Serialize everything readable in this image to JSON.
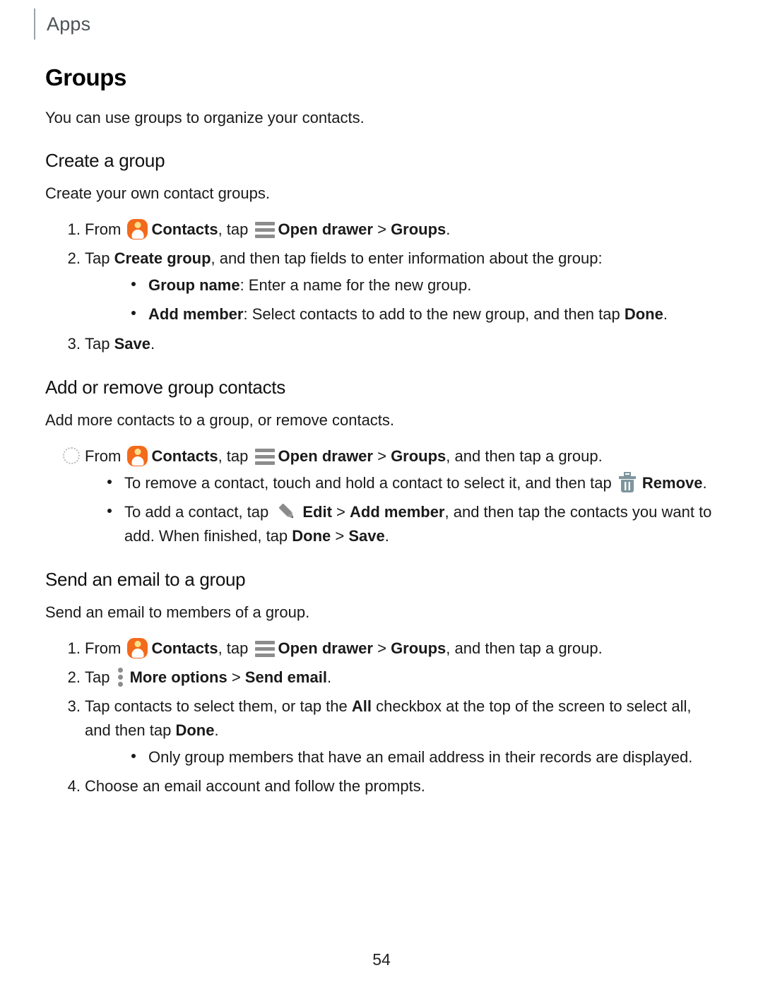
{
  "header": {
    "label": "Apps"
  },
  "doc": {
    "title": "Groups",
    "intro": "You can use groups to organize your contacts."
  },
  "icons": {
    "contacts": "contacts-app-icon",
    "open_drawer": "hamburger-menu-icon",
    "more_options": "more-options-icon",
    "remove": "trash-icon",
    "edit": "pencil-icon"
  },
  "sections": [
    {
      "id": "create-a-group",
      "heading": "Create a group",
      "intro": "Create your own contact groups.",
      "steps": [
        {
          "marker": "1.",
          "parts": [
            {
              "t": "text",
              "v": "From "
            },
            {
              "t": "icon",
              "v": "contacts"
            },
            {
              "t": "bold",
              "v": "Contacts"
            },
            {
              "t": "text",
              "v": ", tap "
            },
            {
              "t": "icon",
              "v": "open_drawer"
            },
            {
              "t": "bold",
              "v": "Open drawer"
            },
            {
              "t": "text",
              "v": " > "
            },
            {
              "t": "bold",
              "v": "Groups"
            },
            {
              "t": "text",
              "v": "."
            }
          ]
        },
        {
          "marker": "2.",
          "parts": [
            {
              "t": "text",
              "v": "Tap "
            },
            {
              "t": "bold",
              "v": "Create group"
            },
            {
              "t": "text",
              "v": ", and then tap fields to enter information about the group:"
            }
          ],
          "subbullets": [
            [
              {
                "t": "bold",
                "v": "Group name"
              },
              {
                "t": "text",
                "v": ": Enter a name for the new group."
              }
            ],
            [
              {
                "t": "bold",
                "v": "Add member"
              },
              {
                "t": "text",
                "v": ": Select contacts to add to the new group, and then tap "
              },
              {
                "t": "bold",
                "v": "Done"
              },
              {
                "t": "text",
                "v": "."
              }
            ]
          ]
        },
        {
          "marker": "3.",
          "parts": [
            {
              "t": "text",
              "v": "Tap "
            },
            {
              "t": "bold",
              "v": "Save"
            },
            {
              "t": "text",
              "v": "."
            }
          ]
        }
      ]
    },
    {
      "id": "add-or-remove-group-contacts",
      "heading": "Add or remove group contacts",
      "intro": "Add more contacts to a group, or remove contacts.",
      "steps": [
        {
          "marker": "ring",
          "parts": [
            {
              "t": "text",
              "v": "From "
            },
            {
              "t": "icon",
              "v": "contacts"
            },
            {
              "t": "bold",
              "v": "Contacts"
            },
            {
              "t": "text",
              "v": ", tap "
            },
            {
              "t": "icon",
              "v": "open_drawer"
            },
            {
              "t": "bold",
              "v": "Open drawer"
            },
            {
              "t": "text",
              "v": " > "
            },
            {
              "t": "bold",
              "v": "Groups"
            },
            {
              "t": "text",
              "v": ", and then tap a group."
            }
          ],
          "subbullets": [
            [
              {
                "t": "text",
                "v": "To remove a contact, touch and hold a contact to select it, and then tap "
              },
              {
                "t": "icon",
                "v": "remove"
              },
              {
                "t": "bold",
                "v": "Remove"
              },
              {
                "t": "text",
                "v": "."
              }
            ],
            [
              {
                "t": "text",
                "v": "To add a contact, tap "
              },
              {
                "t": "icon",
                "v": "edit"
              },
              {
                "t": "bold",
                "v": "Edit"
              },
              {
                "t": "text",
                "v": " > "
              },
              {
                "t": "bold",
                "v": "Add member"
              },
              {
                "t": "text",
                "v": ", and then tap the contacts you want to add. When finished, tap "
              },
              {
                "t": "bold",
                "v": "Done"
              },
              {
                "t": "text",
                "v": " > "
              },
              {
                "t": "bold",
                "v": "Save"
              },
              {
                "t": "text",
                "v": "."
              }
            ]
          ]
        }
      ]
    },
    {
      "id": "send-an-email-to-a-group",
      "heading": "Send an email to a group",
      "intro": "Send an email to members of a group.",
      "steps": [
        {
          "marker": "1.",
          "parts": [
            {
              "t": "text",
              "v": "From "
            },
            {
              "t": "icon",
              "v": "contacts"
            },
            {
              "t": "bold",
              "v": "Contacts"
            },
            {
              "t": "text",
              "v": ", tap "
            },
            {
              "t": "icon",
              "v": "open_drawer"
            },
            {
              "t": "bold",
              "v": "Open drawer"
            },
            {
              "t": "text",
              "v": " > "
            },
            {
              "t": "bold",
              "v": "Groups"
            },
            {
              "t": "text",
              "v": ", and then tap a group."
            }
          ]
        },
        {
          "marker": "2.",
          "parts": [
            {
              "t": "text",
              "v": "Tap "
            },
            {
              "t": "icon",
              "v": "more_options"
            },
            {
              "t": "bold",
              "v": "More options"
            },
            {
              "t": "text",
              "v": " > "
            },
            {
              "t": "bold",
              "v": "Send email"
            },
            {
              "t": "text",
              "v": "."
            }
          ]
        },
        {
          "marker": "3.",
          "parts": [
            {
              "t": "text",
              "v": "Tap contacts to select them, or tap the "
            },
            {
              "t": "bold",
              "v": "All"
            },
            {
              "t": "text",
              "v": " checkbox at the top of the screen to select all, and then tap "
            },
            {
              "t": "bold",
              "v": "Done"
            },
            {
              "t": "text",
              "v": "."
            }
          ],
          "subbullets": [
            [
              {
                "t": "text",
                "v": "Only group members that have an email address in their records are displayed."
              }
            ]
          ]
        },
        {
          "marker": "4.",
          "parts": [
            {
              "t": "text",
              "v": "Choose an email account and follow the prompts."
            }
          ]
        }
      ]
    }
  ],
  "footer": {
    "page_number": "54"
  }
}
